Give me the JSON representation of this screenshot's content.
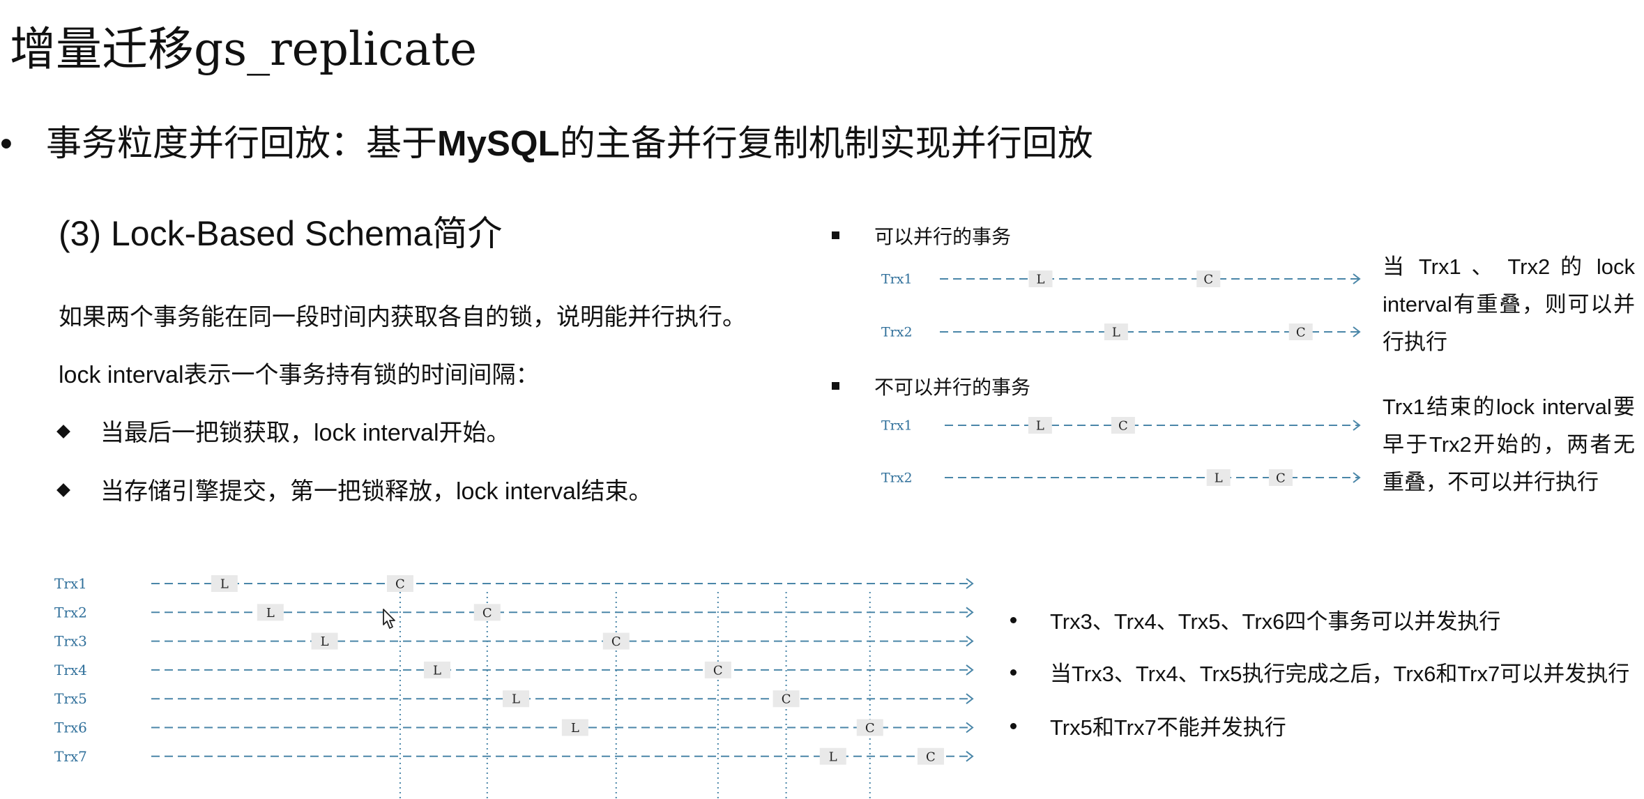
{
  "title": "增量迁移gs_replicate",
  "subtitle": {
    "bullet": "•",
    "before": "事务粒度并行回放：基于",
    "bold": "MySQL",
    "after": "的主备并行复制机制实现并行回放"
  },
  "section_heading": "(3) Lock-Based Schema简介",
  "paragraphs": {
    "p1": "如果两个事务能在同一段时间内获取各自的锁，说明能并行执行。",
    "p2": "lock interval表示一个事务持有锁的时间间隔：",
    "b1": "当最后一把锁获取，lock interval开始。",
    "b2": "当存储引擎提交，第一把锁释放，lock interval结束。"
  },
  "right_top": {
    "parallel_heading": "可以并行的事务",
    "parallel_desc": "当 Trx1 、 Trx2 的 lock interval有重叠，则可以并行执行",
    "nonparallel_heading": "不可以并行的事务",
    "nonparallel_desc": "Trx1结束的lock interval要早于Trx2开始的，两者无重叠，不可以并行执行"
  },
  "diagram_parallel": {
    "rows": [
      {
        "label": "Trx1",
        "markers": [
          {
            "t": "L",
            "at": 0.24
          },
          {
            "t": "C",
            "at": 0.64
          }
        ]
      },
      {
        "label": "Trx2",
        "markers": [
          {
            "t": "L",
            "at": 0.42
          },
          {
            "t": "C",
            "at": 0.86
          }
        ]
      }
    ]
  },
  "diagram_nonparallel": {
    "rows": [
      {
        "label": "Trx1",
        "markers": [
          {
            "t": "L",
            "at": 0.23
          },
          {
            "t": "C",
            "at": 0.43
          }
        ]
      },
      {
        "label": "Trx2",
        "markers": [
          {
            "t": "L",
            "at": 0.66
          },
          {
            "t": "C",
            "at": 0.81
          }
        ]
      }
    ]
  },
  "diagram_main": {
    "rows": [
      {
        "label": "Trx1",
        "markers": [
          {
            "t": "L",
            "at": 0.089
          },
          {
            "t": "C",
            "at": 0.303
          }
        ]
      },
      {
        "label": "Trx2",
        "markers": [
          {
            "t": "L",
            "at": 0.145
          },
          {
            "t": "C",
            "at": 0.409
          }
        ]
      },
      {
        "label": "Trx3",
        "markers": [
          {
            "t": "L",
            "at": 0.211
          },
          {
            "t": "C",
            "at": 0.566
          }
        ]
      },
      {
        "label": "Trx4",
        "markers": [
          {
            "t": "L",
            "at": 0.348
          },
          {
            "t": "C",
            "at": 0.69
          }
        ]
      },
      {
        "label": "Trx5",
        "markers": [
          {
            "t": "L",
            "at": 0.444
          },
          {
            "t": "C",
            "at": 0.773
          }
        ]
      },
      {
        "label": "Trx6",
        "markers": [
          {
            "t": "L",
            "at": 0.516
          },
          {
            "t": "C",
            "at": 0.875
          }
        ]
      },
      {
        "label": "Trx7",
        "markers": [
          {
            "t": "L",
            "at": 0.83
          },
          {
            "t": "C",
            "at": 0.949
          }
        ]
      }
    ],
    "guides": [
      0.303,
      0.409,
      0.566,
      0.69,
      0.773,
      0.875
    ]
  },
  "right_bottom": {
    "items": [
      "Trx3、Trx4、Trx5、Trx6四个事务可以并发执行",
      "当Trx3、Trx4、Trx5执行完成之后，Trx6和Trx7可以并发执行",
      "Trx5和Trx7不能并发执行"
    ]
  },
  "colors": {
    "line": "#4a86a8",
    "label": "#2f6f9a",
    "box": "#e9e9e9",
    "guide": "#4a86a8"
  },
  "icons": {
    "cursor": "mouse-pointer-icon"
  }
}
